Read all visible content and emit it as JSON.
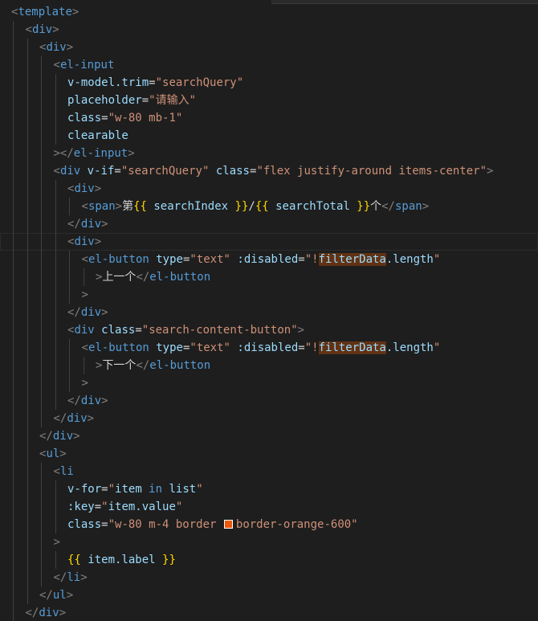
{
  "theme": {
    "background": "#1e1e1e",
    "tag_color": "#569cd6",
    "bracket_color": "#808080",
    "attribute_color": "#9cdcfe",
    "string_color": "#ce9178",
    "text_color": "#d4d4d4",
    "interpolation_color": "#ffd700",
    "highlight_color": "#613214",
    "swatch_color": "#ea580c"
  },
  "code_lines": [
    {
      "indent": 0,
      "tokens": [
        {
          "t": "<",
          "c": "punc"
        },
        {
          "t": "template",
          "c": "tag"
        },
        {
          "t": ">",
          "c": "punc"
        }
      ]
    },
    {
      "indent": 1,
      "tokens": [
        {
          "t": "<",
          "c": "punc"
        },
        {
          "t": "div",
          "c": "tag"
        },
        {
          "t": ">",
          "c": "punc"
        }
      ]
    },
    {
      "indent": 2,
      "tokens": [
        {
          "t": "<",
          "c": "punc"
        },
        {
          "t": "div",
          "c": "tag"
        },
        {
          "t": ">",
          "c": "punc"
        }
      ]
    },
    {
      "indent": 3,
      "tokens": [
        {
          "t": "<",
          "c": "punc"
        },
        {
          "t": "el-input",
          "c": "tag"
        }
      ]
    },
    {
      "indent": 4,
      "tokens": [
        {
          "t": "v-model.trim",
          "c": "attr"
        },
        {
          "t": "=",
          "c": "text"
        },
        {
          "t": "\"searchQuery\"",
          "c": "str"
        }
      ]
    },
    {
      "indent": 4,
      "tokens": [
        {
          "t": "placeholder",
          "c": "attr"
        },
        {
          "t": "=",
          "c": "text"
        },
        {
          "t": "\"请输入\"",
          "c": "str"
        }
      ]
    },
    {
      "indent": 4,
      "tokens": [
        {
          "t": "class",
          "c": "attr"
        },
        {
          "t": "=",
          "c": "text"
        },
        {
          "t": "\"w-80 mb-1\"",
          "c": "str"
        }
      ]
    },
    {
      "indent": 4,
      "tokens": [
        {
          "t": "clearable",
          "c": "attr"
        }
      ]
    },
    {
      "indent": 3,
      "tokens": [
        {
          "t": "></",
          "c": "punc"
        },
        {
          "t": "el-input",
          "c": "tag"
        },
        {
          "t": ">",
          "c": "punc"
        }
      ]
    },
    {
      "indent": 3,
      "tokens": [
        {
          "t": "<",
          "c": "punc"
        },
        {
          "t": "div",
          "c": "tag"
        },
        {
          "t": " ",
          "c": "text"
        },
        {
          "t": "v-if",
          "c": "attr"
        },
        {
          "t": "=",
          "c": "text"
        },
        {
          "t": "\"searchQuery\"",
          "c": "str"
        },
        {
          "t": " ",
          "c": "text"
        },
        {
          "t": "class",
          "c": "attr"
        },
        {
          "t": "=",
          "c": "text"
        },
        {
          "t": "\"flex justify-around items-center\"",
          "c": "str"
        },
        {
          "t": ">",
          "c": "punc"
        }
      ]
    },
    {
      "indent": 4,
      "tokens": [
        {
          "t": "<",
          "c": "punc"
        },
        {
          "t": "div",
          "c": "tag"
        },
        {
          "t": ">",
          "c": "punc"
        }
      ]
    },
    {
      "indent": 5,
      "tokens": [
        {
          "t": "<",
          "c": "punc"
        },
        {
          "t": "span",
          "c": "tag"
        },
        {
          "t": ">",
          "c": "punc"
        },
        {
          "t": "第",
          "c": "text"
        },
        {
          "t": "{{",
          "c": "brace"
        },
        {
          "t": " searchIndex ",
          "c": "attr"
        },
        {
          "t": "}}",
          "c": "brace"
        },
        {
          "t": "/",
          "c": "text"
        },
        {
          "t": "{{",
          "c": "brace"
        },
        {
          "t": " searchTotal ",
          "c": "attr"
        },
        {
          "t": "}}",
          "c": "brace"
        },
        {
          "t": "个",
          "c": "text"
        },
        {
          "t": "</",
          "c": "punc"
        },
        {
          "t": "span",
          "c": "tag"
        },
        {
          "t": ">",
          "c": "punc"
        }
      ]
    },
    {
      "indent": 4,
      "tokens": [
        {
          "t": "</",
          "c": "punc"
        },
        {
          "t": "div",
          "c": "tag"
        },
        {
          "t": ">",
          "c": "punc"
        }
      ]
    },
    {
      "indent": 4,
      "current": true,
      "tokens": [
        {
          "t": "<",
          "c": "punc"
        },
        {
          "t": "div",
          "c": "tag"
        },
        {
          "t": ">",
          "c": "punc"
        }
      ]
    },
    {
      "indent": 5,
      "tokens": [
        {
          "t": "<",
          "c": "punc"
        },
        {
          "t": "el-button",
          "c": "tag"
        },
        {
          "t": " ",
          "c": "text"
        },
        {
          "t": "type",
          "c": "attr"
        },
        {
          "t": "=",
          "c": "text"
        },
        {
          "t": "\"text\"",
          "c": "str"
        },
        {
          "t": " ",
          "c": "text"
        },
        {
          "t": ":disabled",
          "c": "attr"
        },
        {
          "t": "=",
          "c": "text"
        },
        {
          "t": "\"!",
          "c": "str"
        },
        {
          "t": "filterData",
          "c": "attr",
          "hl": true
        },
        {
          "t": ".length",
          "c": "attr"
        },
        {
          "t": "\"",
          "c": "str"
        }
      ]
    },
    {
      "indent": 6,
      "tokens": [
        {
          "t": ">",
          "c": "punc"
        },
        {
          "t": "上一个",
          "c": "text"
        },
        {
          "t": "</",
          "c": "punc"
        },
        {
          "t": "el-button",
          "c": "tag"
        }
      ]
    },
    {
      "indent": 5,
      "tokens": [
        {
          "t": ">",
          "c": "punc"
        }
      ]
    },
    {
      "indent": 4,
      "tokens": [
        {
          "t": "</",
          "c": "punc"
        },
        {
          "t": "div",
          "c": "tag"
        },
        {
          "t": ">",
          "c": "punc"
        }
      ]
    },
    {
      "indent": 4,
      "tokens": [
        {
          "t": "<",
          "c": "punc"
        },
        {
          "t": "div",
          "c": "tag"
        },
        {
          "t": " ",
          "c": "text"
        },
        {
          "t": "class",
          "c": "attr"
        },
        {
          "t": "=",
          "c": "text"
        },
        {
          "t": "\"search-content-button\"",
          "c": "str"
        },
        {
          "t": ">",
          "c": "punc"
        }
      ]
    },
    {
      "indent": 5,
      "tokens": [
        {
          "t": "<",
          "c": "punc"
        },
        {
          "t": "el-button",
          "c": "tag"
        },
        {
          "t": " ",
          "c": "text"
        },
        {
          "t": "type",
          "c": "attr"
        },
        {
          "t": "=",
          "c": "text"
        },
        {
          "t": "\"text\"",
          "c": "str"
        },
        {
          "t": " ",
          "c": "text"
        },
        {
          "t": ":disabled",
          "c": "attr"
        },
        {
          "t": "=",
          "c": "text"
        },
        {
          "t": "\"!",
          "c": "str"
        },
        {
          "t": "filterData",
          "c": "attr",
          "hl": true
        },
        {
          "t": ".length",
          "c": "attr"
        },
        {
          "t": "\"",
          "c": "str"
        }
      ]
    },
    {
      "indent": 6,
      "tokens": [
        {
          "t": ">",
          "c": "punc"
        },
        {
          "t": "下一个",
          "c": "text"
        },
        {
          "t": "</",
          "c": "punc"
        },
        {
          "t": "el-button",
          "c": "tag"
        }
      ]
    },
    {
      "indent": 5,
      "tokens": [
        {
          "t": ">",
          "c": "punc"
        }
      ]
    },
    {
      "indent": 4,
      "tokens": [
        {
          "t": "</",
          "c": "punc"
        },
        {
          "t": "div",
          "c": "tag"
        },
        {
          "t": ">",
          "c": "punc"
        }
      ]
    },
    {
      "indent": 3,
      "tokens": [
        {
          "t": "</",
          "c": "punc"
        },
        {
          "t": "div",
          "c": "tag"
        },
        {
          "t": ">",
          "c": "punc"
        }
      ]
    },
    {
      "indent": 2,
      "tokens": [
        {
          "t": "</",
          "c": "punc"
        },
        {
          "t": "div",
          "c": "tag"
        },
        {
          "t": ">",
          "c": "punc"
        }
      ]
    },
    {
      "indent": 2,
      "tokens": [
        {
          "t": "<",
          "c": "punc"
        },
        {
          "t": "ul",
          "c": "tag"
        },
        {
          "t": ">",
          "c": "punc"
        }
      ]
    },
    {
      "indent": 3,
      "tokens": [
        {
          "t": "<",
          "c": "punc"
        },
        {
          "t": "li",
          "c": "tag"
        }
      ]
    },
    {
      "indent": 4,
      "tokens": [
        {
          "t": "v-for",
          "c": "attr"
        },
        {
          "t": "=",
          "c": "text"
        },
        {
          "t": "\"",
          "c": "str"
        },
        {
          "t": "item",
          "c": "attr"
        },
        {
          "t": " in ",
          "c": "tag"
        },
        {
          "t": "list",
          "c": "attr"
        },
        {
          "t": "\"",
          "c": "str"
        }
      ]
    },
    {
      "indent": 4,
      "tokens": [
        {
          "t": ":key",
          "c": "attr"
        },
        {
          "t": "=",
          "c": "text"
        },
        {
          "t": "\"",
          "c": "str"
        },
        {
          "t": "item.value",
          "c": "attr"
        },
        {
          "t": "\"",
          "c": "str"
        }
      ]
    },
    {
      "indent": 4,
      "tokens": [
        {
          "t": "class",
          "c": "attr"
        },
        {
          "t": "=",
          "c": "text"
        },
        {
          "t": "\"w-80 m-4 border ",
          "c": "str"
        },
        {
          "swatch": true
        },
        {
          "t": "border-orange-600\"",
          "c": "str"
        }
      ]
    },
    {
      "indent": 3,
      "tokens": [
        {
          "t": ">",
          "c": "punc"
        }
      ]
    },
    {
      "indent": 4,
      "tokens": [
        {
          "t": "{{",
          "c": "brace"
        },
        {
          "t": " item.label ",
          "c": "attr"
        },
        {
          "t": "}}",
          "c": "brace"
        }
      ]
    },
    {
      "indent": 3,
      "tokens": [
        {
          "t": "</",
          "c": "punc"
        },
        {
          "t": "li",
          "c": "tag"
        },
        {
          "t": ">",
          "c": "punc"
        }
      ]
    },
    {
      "indent": 2,
      "tokens": [
        {
          "t": "</",
          "c": "punc"
        },
        {
          "t": "ul",
          "c": "tag"
        },
        {
          "t": ">",
          "c": "punc"
        }
      ]
    },
    {
      "indent": 1,
      "tokens": [
        {
          "t": "</",
          "c": "punc"
        },
        {
          "t": "div",
          "c": "tag"
        },
        {
          "t": ">",
          "c": "punc"
        }
      ]
    }
  ]
}
